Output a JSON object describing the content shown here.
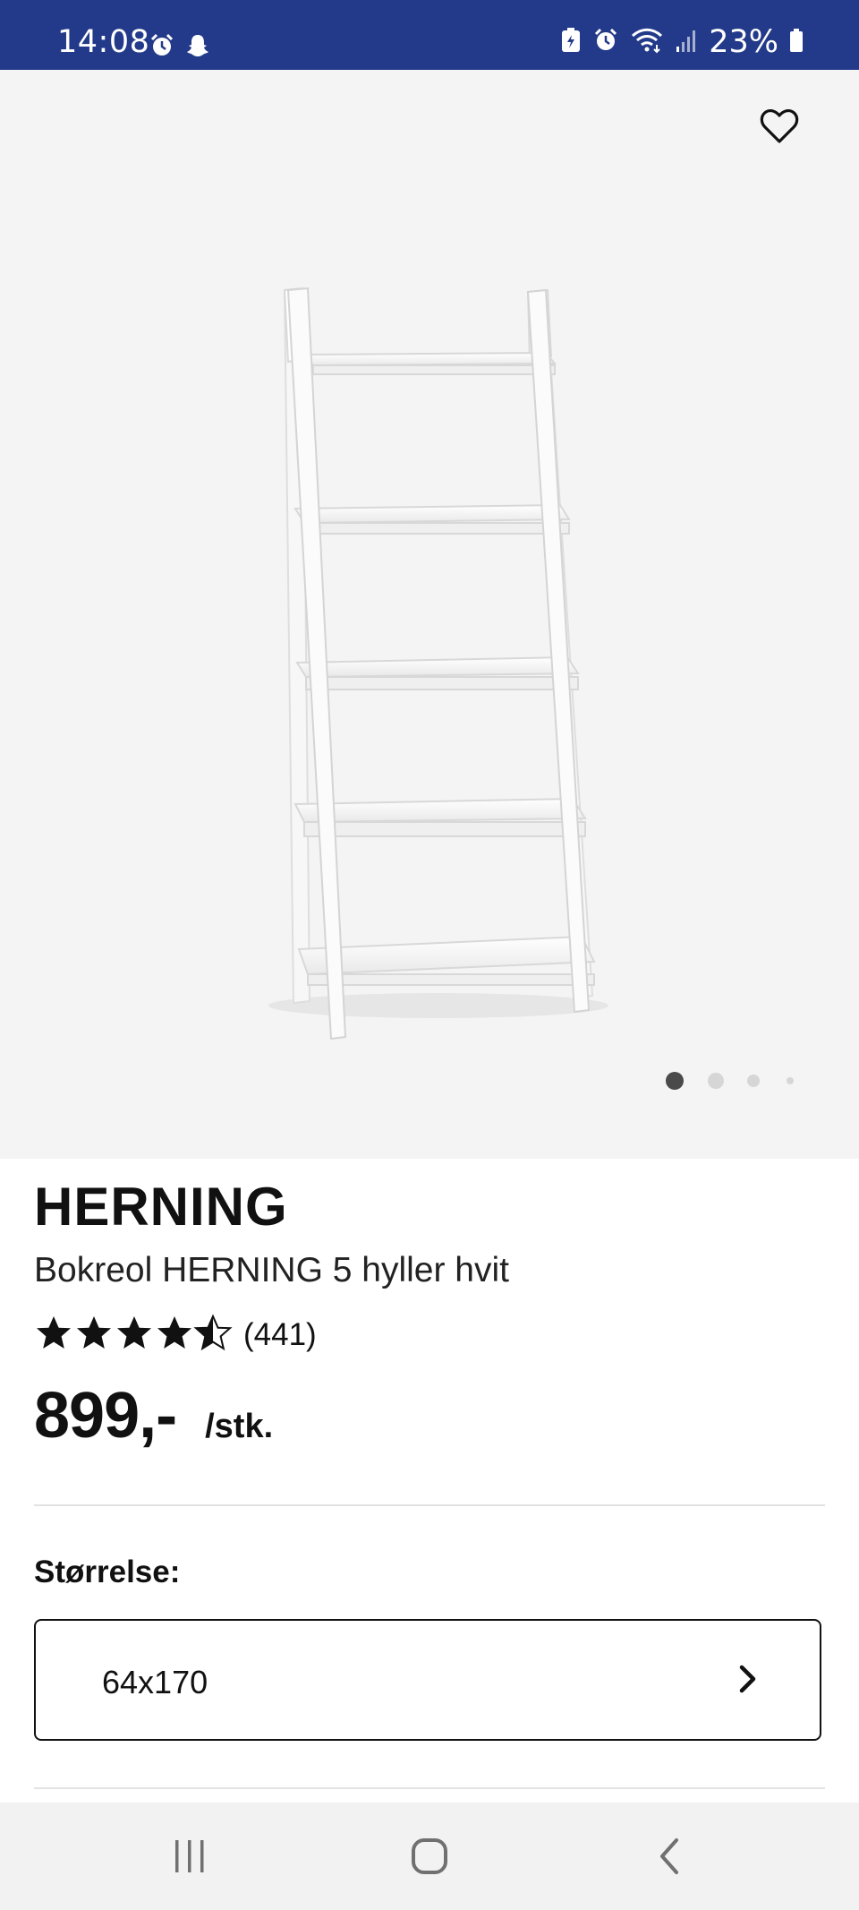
{
  "status_bar": {
    "time": "14:08",
    "battery": "23%",
    "left_icons": [
      "alarm-icon",
      "snapchat-icon"
    ],
    "right_icons": [
      "battery-saver-icon",
      "alarm-icon",
      "wifi-icon",
      "signal-icon",
      "battery-icon"
    ]
  },
  "gallery": {
    "favorite_icon": "heart-outline-icon",
    "image_subject": "white ladder bookcase",
    "dots_count": 4,
    "active_index": 0
  },
  "product": {
    "brand": "HERNING",
    "name": "Bokreol HERNING 5 hyller hvit",
    "rating": 4.5,
    "rating_max": 5,
    "review_count": "(441)",
    "price": "899,-",
    "unit": "/stk."
  },
  "size": {
    "label": "Størrelse:",
    "value": "64x170"
  },
  "navbar": {
    "icons": [
      "recent-apps-icon",
      "home-icon",
      "back-icon"
    ]
  },
  "colors": {
    "status_bar": "#233a8a",
    "gallery_bg": "#f4f4f4",
    "text": "#111111"
  }
}
